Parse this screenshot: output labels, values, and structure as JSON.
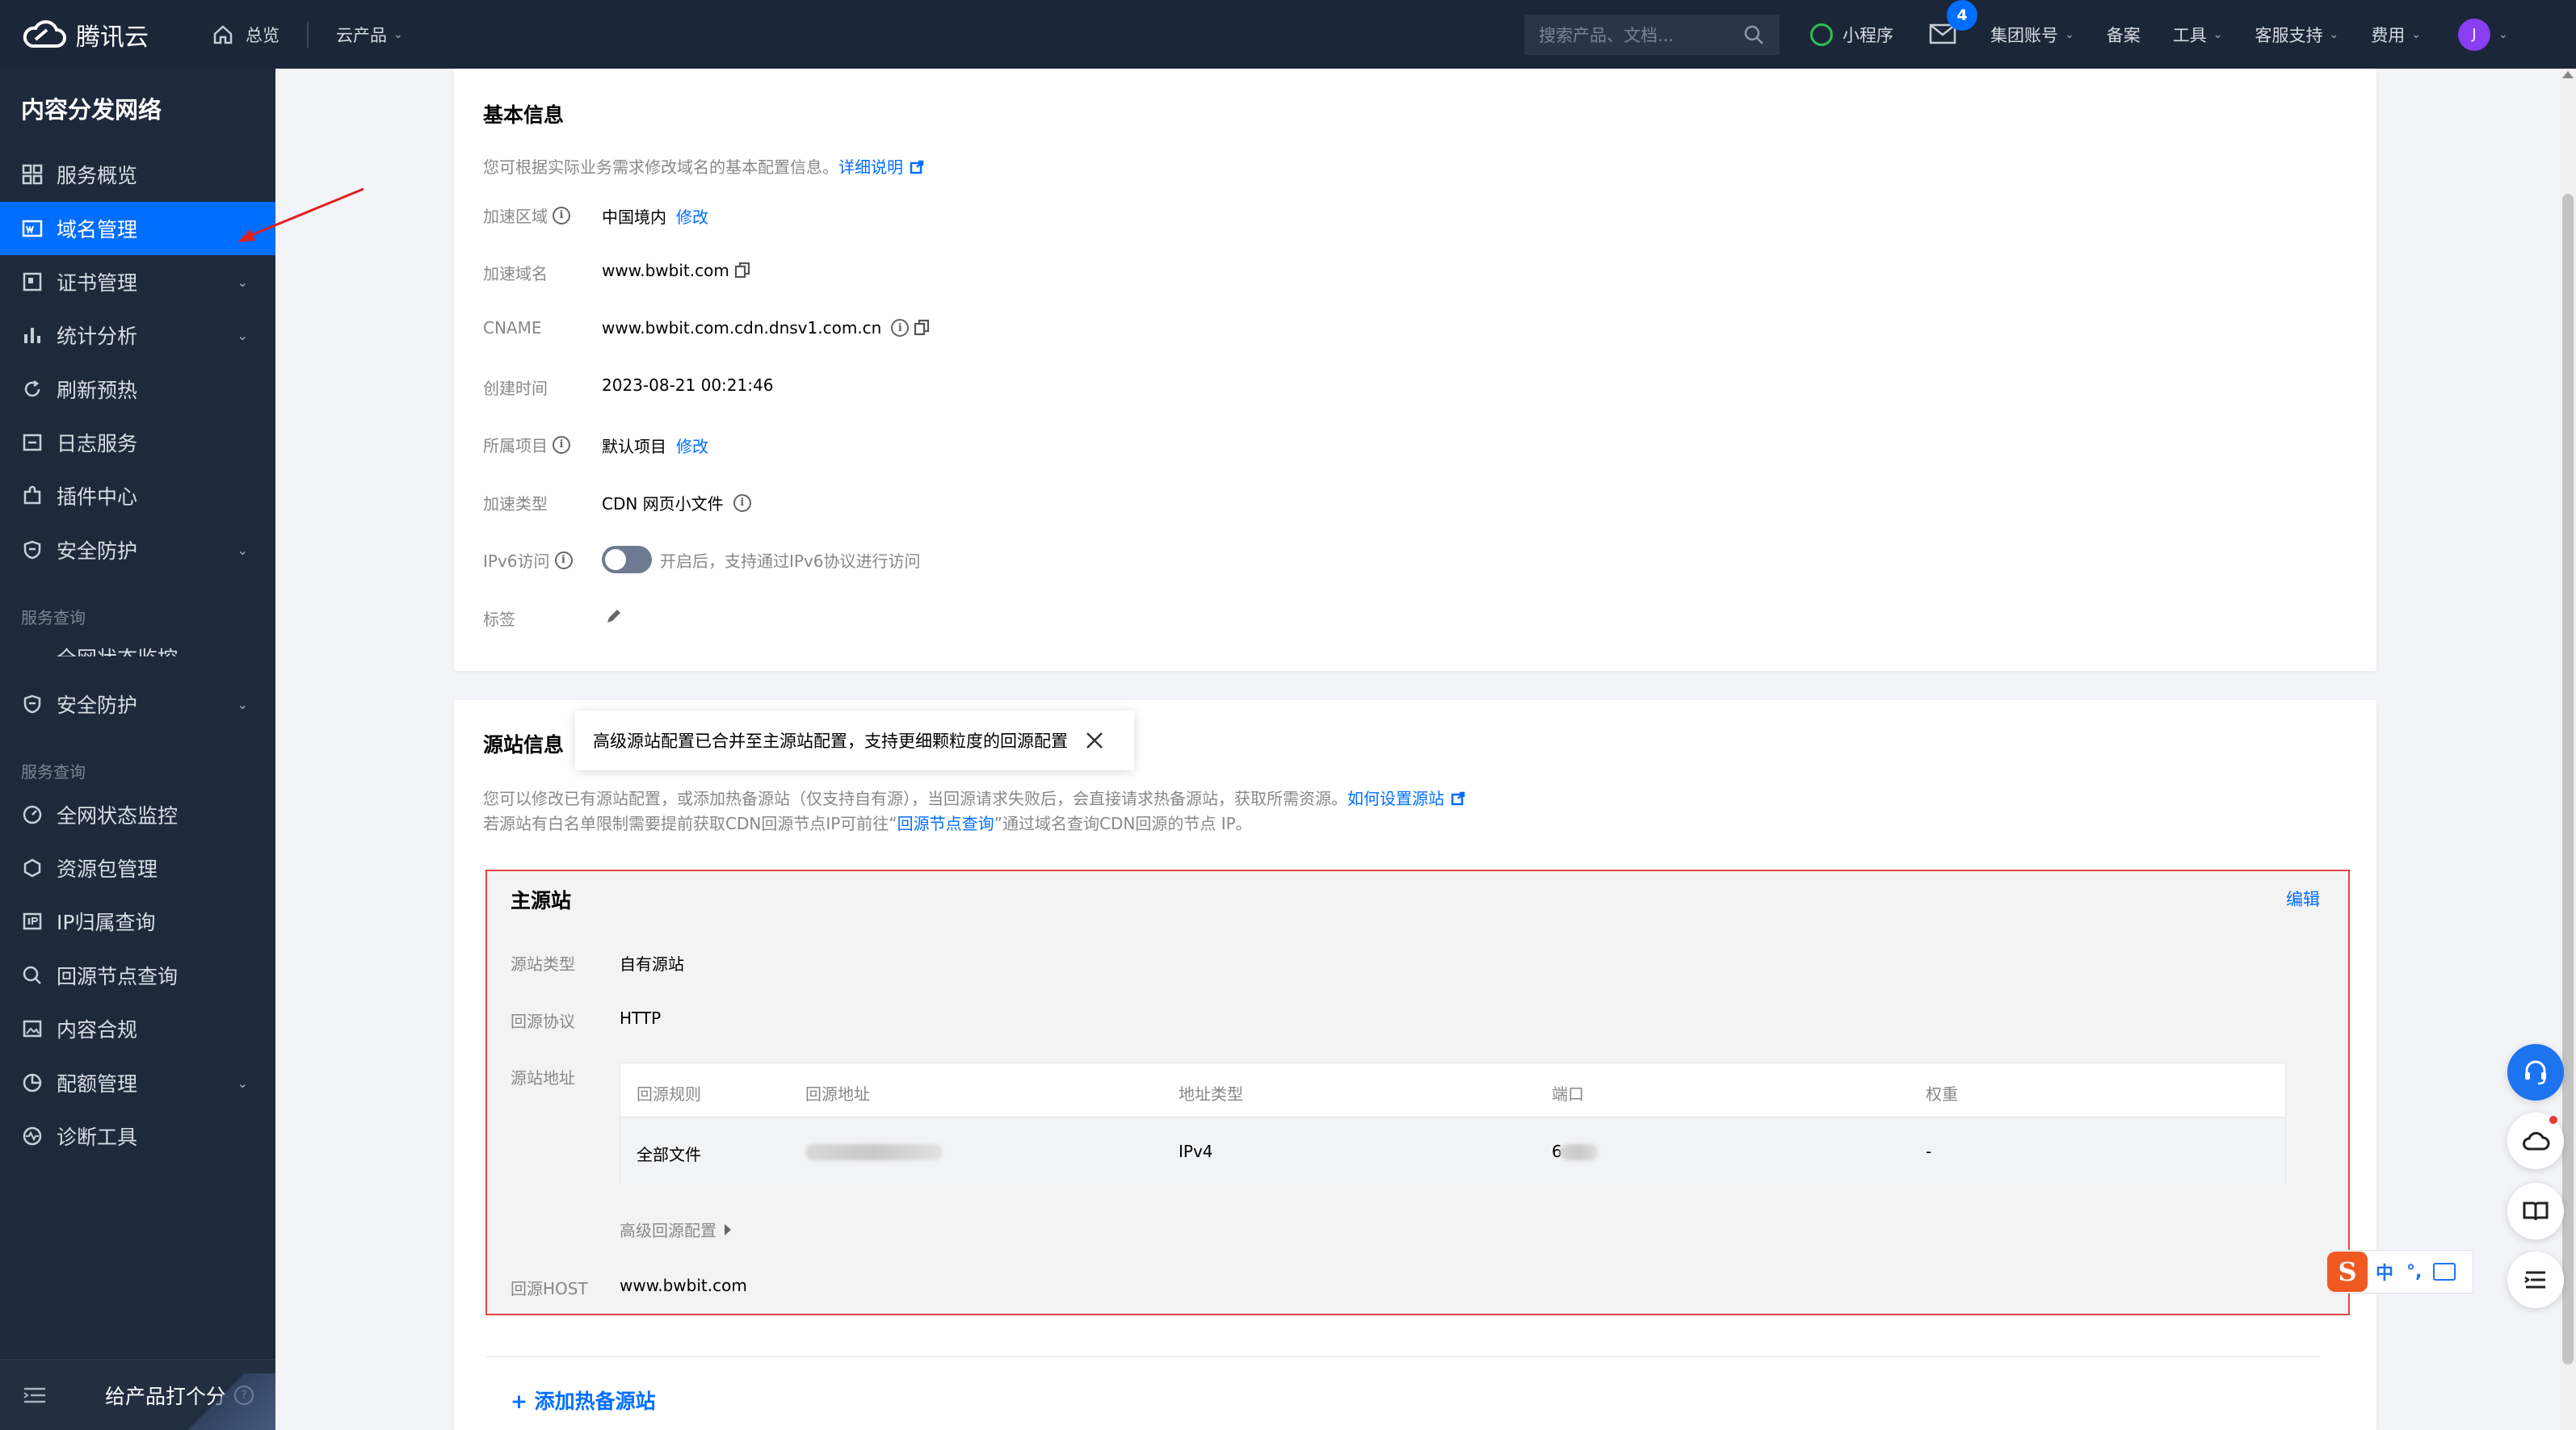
{
  "topbar": {
    "brand": "腾讯云",
    "home": "总览",
    "products": "云产品",
    "search_placeholder": "搜索产品、文档...",
    "mini_program": "小程序",
    "mail_badge": "4",
    "group_account": "集团账号",
    "beian": "备案",
    "tools": "工具",
    "support": "客服支持",
    "billing": "费用",
    "avatar_initial": "J"
  },
  "sidebar": {
    "title": "内容分发网络",
    "items": [
      {
        "label": "服务概览"
      },
      {
        "label": "域名管理"
      },
      {
        "label": "证书管理"
      },
      {
        "label": "统计分析"
      },
      {
        "label": "刷新预热"
      },
      {
        "label": "日志服务"
      },
      {
        "label": "插件中心"
      },
      {
        "label": "安全防护"
      }
    ],
    "group1": "服务查询",
    "clipped_item": "全网状态监控",
    "items2": [
      {
        "label": "安全防护"
      }
    ],
    "group2": "服务查询",
    "items3": [
      {
        "label": "全网状态监控"
      },
      {
        "label": "资源包管理"
      },
      {
        "label": "IP归属查询"
      },
      {
        "label": "回源节点查询"
      },
      {
        "label": "内容合规"
      },
      {
        "label": "配额管理"
      },
      {
        "label": "诊断工具"
      }
    ],
    "rate": "给产品打个分"
  },
  "basic": {
    "title": "基本信息",
    "desc": "您可根据实际业务需求修改域名的基本配置信息。",
    "desc_link": "详细说明",
    "region_label": "加速区域",
    "region_value": "中国境内",
    "modify": "修改",
    "domain_label": "加速域名",
    "domain_value": "www.bwbit.com",
    "cname_label": "CNAME",
    "cname_value": "www.bwbit.com.cdn.dnsv1.com.cn",
    "created_label": "创建时间",
    "created_value": "2023-08-21 00:21:46",
    "project_label": "所属项目",
    "project_value": "默认项目",
    "type_label": "加速类型",
    "type_value": "CDN 网页小文件",
    "ipv6_label": "IPv6访问",
    "ipv6_desc": "开启后，支持通过IPv6协议进行访问",
    "tag_label": "标签"
  },
  "origin": {
    "title": "源站信息",
    "tooltip": "高级源站配置已合并至主源站配置，支持更细颗粒度的回源配置",
    "desc1": "您可以修改已有源站配置，或添加热备源站（仅支持自有源），当回源请求失败后，会直接请求热备源站，获取所需资源。",
    "desc1_link": "如何设置源站",
    "desc2_pre": "若源站有白名单限制需要提前获取CDN回源节点IP可前往“",
    "desc2_link": "回源节点查询",
    "desc2_post": "”通过域名查询CDN回源的节点 IP。",
    "main_title": "主源站",
    "edit": "编辑",
    "type_label": "源站类型",
    "type_value": "自有源站",
    "protocol_label": "回源协议",
    "protocol_value": "HTTP",
    "addr_label": "源站地址",
    "table_headers": [
      "回源规则",
      "回源地址",
      "地址类型",
      "端口",
      "权重"
    ],
    "table_rows": [
      {
        "rule": "全部文件",
        "addr_type": "IPv4",
        "port_prefix": "6",
        "weight": "-"
      }
    ],
    "advanced": "高级回源配置",
    "host_label": "回源HOST",
    "host_value": "www.bwbit.com",
    "add_hot": "+ 添加热备源站"
  },
  "ime": {
    "logo": "S",
    "zh": "中",
    "punct": "°,"
  },
  "colors": {
    "brand_blue": "#006eff",
    "sidebar_bg": "#1e2a3b",
    "topbar_bg": "#1b2638",
    "highlight_red": "#e54545"
  }
}
